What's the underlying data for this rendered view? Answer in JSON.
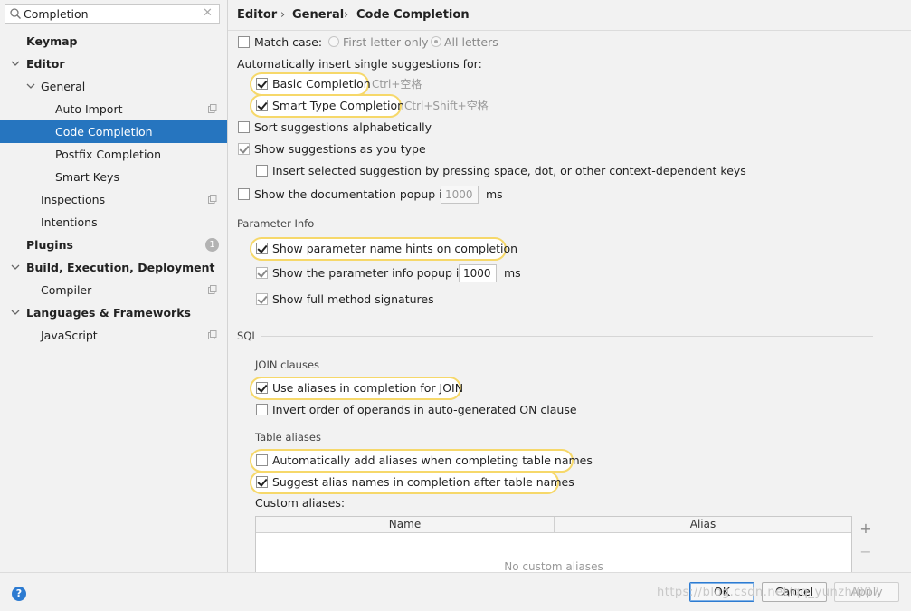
{
  "search": {
    "value": "Completion"
  },
  "sidebar": {
    "items": [
      {
        "label": "Keymap"
      },
      {
        "label": "Editor"
      },
      {
        "label": "General"
      },
      {
        "label": "Auto Import"
      },
      {
        "label": "Code Completion"
      },
      {
        "label": "Postfix Completion"
      },
      {
        "label": "Smart Keys"
      },
      {
        "label": "Inspections"
      },
      {
        "label": "Intentions"
      },
      {
        "label": "Plugins",
        "badge": "1"
      },
      {
        "label": "Build, Execution, Deployment"
      },
      {
        "label": "Compiler"
      },
      {
        "label": "Languages & Frameworks"
      },
      {
        "label": "JavaScript"
      }
    ]
  },
  "breadcrumb": {
    "part1": "Editor",
    "part2": "General",
    "part3": "Code Completion",
    "sep": "›"
  },
  "settings": {
    "match_case": "Match case:",
    "first_letter_only": "First letter only",
    "all_letters": "All letters",
    "auto_insert_title": "Automatically insert single suggestions for:",
    "basic_completion": "Basic Completion",
    "basic_shortcut": "Ctrl+空格",
    "smart_completion": "Smart Type Completion",
    "smart_shortcut": "Ctrl+Shift+空格",
    "sort_alpha": "Sort suggestions alphabetically",
    "show_as_you_type": "Show suggestions as you type",
    "insert_selected": "Insert selected suggestion by pressing space, dot, or other context-dependent keys",
    "show_doc_popup": "Show the documentation popup in",
    "doc_popup_ms": "1000",
    "ms": "ms"
  },
  "parameter_info": {
    "title": "Parameter Info",
    "name_hints": "Show parameter name hints on completion",
    "info_popup": "Show the parameter info popup in",
    "info_popup_ms": "1000",
    "ms": "ms",
    "full_signatures": "Show full method signatures"
  },
  "sql": {
    "title": "SQL",
    "join_clauses": "JOIN clauses",
    "use_aliases": "Use aliases in completion for JOIN",
    "invert_order": "Invert order of operands in auto-generated ON clause",
    "table_aliases": "Table aliases",
    "auto_add_aliases": "Automatically add aliases when completing table names",
    "suggest_alias": "Suggest alias names in completion after table names",
    "custom_aliases": "Custom aliases:",
    "col_name": "Name",
    "col_alias": "Alias",
    "empty": "No custom aliases",
    "add": "+",
    "remove": "−"
  },
  "footer": {
    "help": "?",
    "ok": "OK",
    "cancel": "Cancel",
    "apply": "Apply",
    "watermark": "https://blog.csdn.net/qq_yunzhi007"
  }
}
